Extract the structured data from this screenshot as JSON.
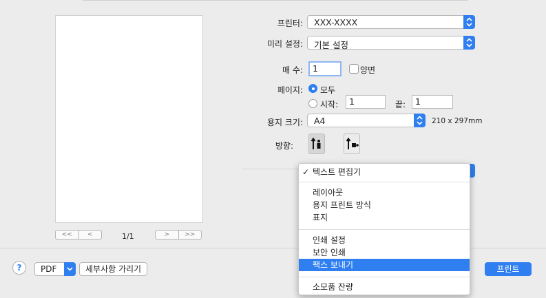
{
  "preview": {
    "page_indicator": "1/1",
    "nav_first": "<<",
    "nav_prev": "<",
    "nav_next": ">",
    "nav_last": ">>"
  },
  "printer": {
    "label": "프린터:",
    "value": "XXX-XXXX"
  },
  "preset": {
    "label": "미리 설정:",
    "value": "기본 설정"
  },
  "copies": {
    "label": "매 수:",
    "value": "1",
    "duplex_label": "양면"
  },
  "pages": {
    "label": "페이지:",
    "all_label": "모두",
    "from_label": "시작:",
    "from_value": "1",
    "to_label": "끝:",
    "to_value": "1"
  },
  "paper": {
    "label": "용지 크기:",
    "value": "A4",
    "dimensions": "210 x 297mm"
  },
  "orientation": {
    "label": "방향:"
  },
  "menu": {
    "items": [
      {
        "label": "텍스트 편집기",
        "checked": true
      },
      {
        "label": "레이아웃"
      },
      {
        "label": "용지 프린트 방식"
      },
      {
        "label": "표지"
      },
      {
        "label": "인쇄 설정"
      },
      {
        "label": "보안 인쇄"
      },
      {
        "label": "팩스 보내기",
        "highlighted": true
      },
      {
        "label": "소모품 잔량"
      }
    ]
  },
  "footer": {
    "help": "?",
    "pdf": "PDF",
    "details": "세부사항 가리기",
    "print": "프린트"
  },
  "colors": {
    "accent": "#2f7ff0"
  }
}
